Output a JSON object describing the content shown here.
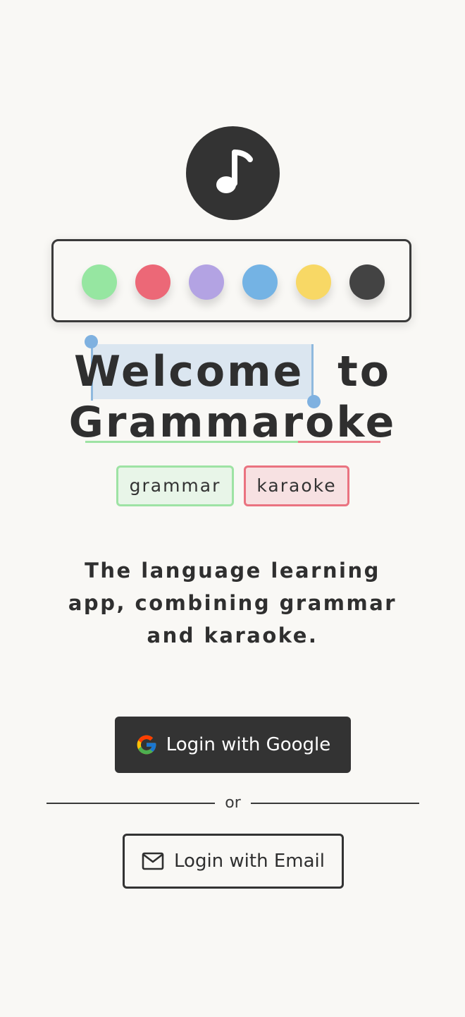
{
  "palette": {
    "colors": [
      "#96e6a1",
      "#ec6877",
      "#b3a3e3",
      "#74b3e4",
      "#f8d865",
      "#434343"
    ]
  },
  "icons": {
    "logo": "music-note-icon",
    "google": "google-g-icon",
    "email": "envelope-icon"
  },
  "title": {
    "word_selected": "Welcome",
    "word_to": "to",
    "app_name": "Grammaroke"
  },
  "tags": {
    "grammar": "grammar",
    "karaoke": "karaoke"
  },
  "tagline": "The language learning app, combining grammar and karaoke.",
  "buttons": {
    "google_label": "Login with Google",
    "divider_text": "or",
    "email_label": "Login with Email"
  }
}
